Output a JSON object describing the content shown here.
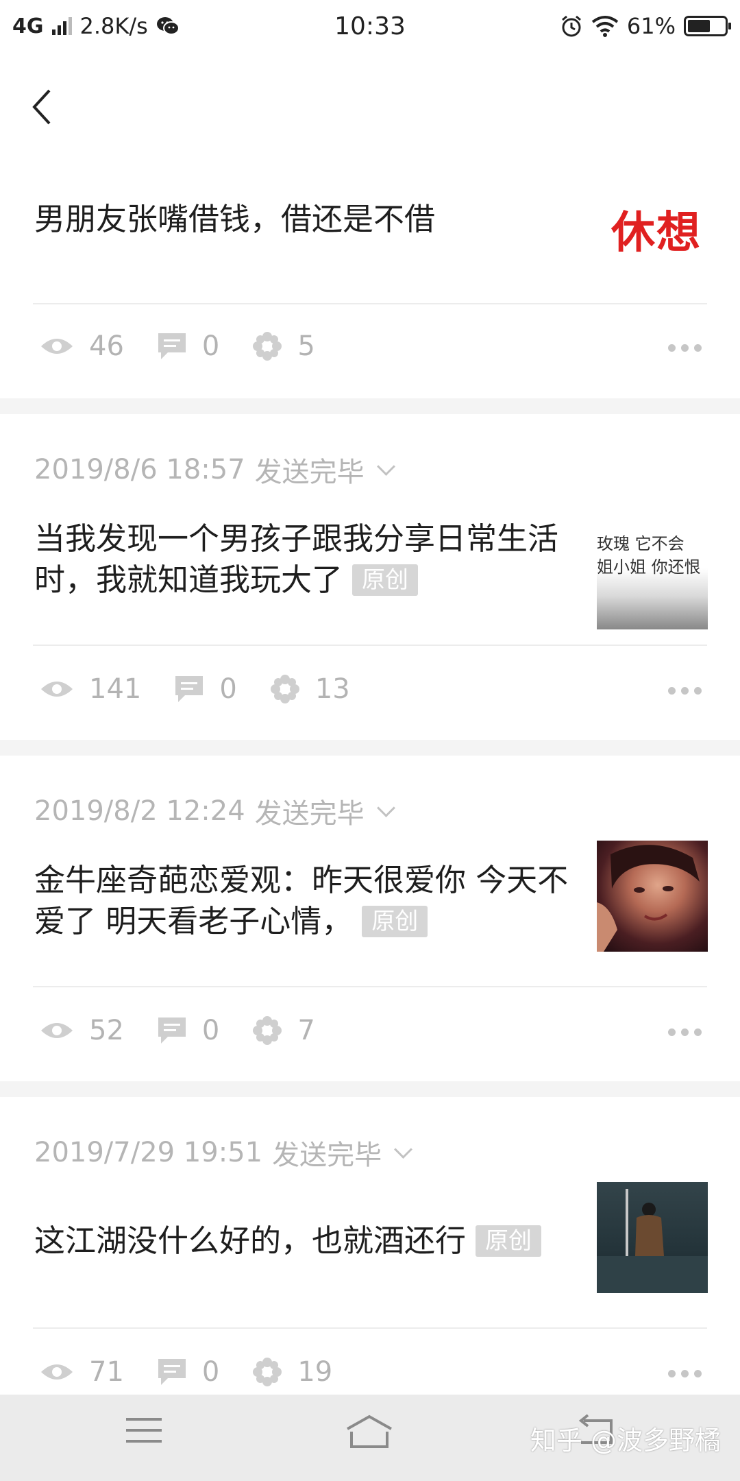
{
  "status_bar": {
    "network": "4G",
    "speed": "2.8K/s",
    "time": "10:33",
    "battery": "61%",
    "battery_level": 0.61
  },
  "posts": [
    {
      "title": "男朋友张嘴借钱，借还是不借",
      "thumb_text": "休想",
      "thumb_color": "#e02020",
      "views": "46",
      "comments": "0",
      "likes": "5"
    },
    {
      "date": "2019/8/6 18:57",
      "status": "发送完毕",
      "title": "当我发现一个男孩子跟我分享日常生活时，我就知道我玩大了",
      "tag": "原创",
      "thumb_line1": "玫瑰 它不会",
      "thumb_line2": "姐小姐 你还恨",
      "views": "141",
      "comments": "0",
      "likes": "13"
    },
    {
      "date": "2019/8/2 12:24",
      "status": "发送完毕",
      "title": "金牛座奇葩恋爱观：昨天很爱你  今天不爱了  明天看老子心情，",
      "tag": "原创",
      "views": "52",
      "comments": "0",
      "likes": "7"
    },
    {
      "date": "2019/7/29 19:51",
      "status": "发送完毕",
      "title": "这江湖没什么好的，也就酒还行",
      "tag": "原创",
      "views": "71",
      "comments": "0",
      "likes": "19"
    }
  ],
  "watermark": "知乎 @波多野橘",
  "colors": {
    "accent_red": "#e02020",
    "muted_text": "#b3b3b3",
    "background": "#f4f4f4"
  }
}
